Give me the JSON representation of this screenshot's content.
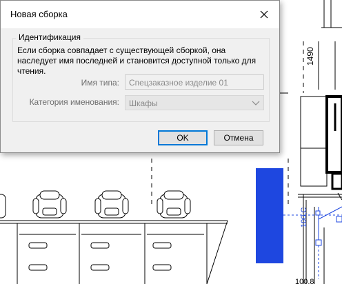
{
  "dialog": {
    "title": "Новая сборка",
    "close_icon": "close-icon",
    "group_title": "Идентификация",
    "description": "Если сборка совпадает с существующей сборкой, она наследует имя последней и становится доступной только для чтения.",
    "type_name_label": "Имя типа:",
    "type_name_value": "Спецзаказное изделие 01",
    "naming_category_label": "Категория именования:",
    "naming_category_value": "Шкафы",
    "ok_label": "OK",
    "cancel_label": "Отмена"
  },
  "background": {
    "dim_1490": "1490",
    "dim_100_c": "100,C",
    "dim_100_8": "100,8",
    "selected_element_color": "#1e47e0"
  }
}
